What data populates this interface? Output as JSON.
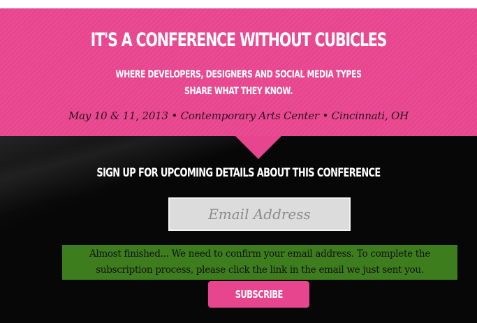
{
  "hero": {
    "title": "IT'S A CONFERENCE WITHOUT CUBICLES",
    "subtitle_line1": "WHERE DEVELOPERS, DESIGNERS AND SOCIAL MEDIA TYPES",
    "subtitle_line2": "SHARE WHAT THEY KNOW.",
    "event_details": "May 10 & 11, 2013 • Contemporary Arts Center • Cincinnati, OH"
  },
  "signup": {
    "heading": "SIGN UP FOR UPCOMING DETAILS ABOUT THIS CONFERENCE",
    "email_placeholder": "Email Address",
    "email_value": "",
    "confirmation_message": "Almost finished... We need to confirm your email address. To complete the subscription process, please click the link in the email we just sent you.",
    "subscribe_label": "SUBSCRIBE"
  },
  "colors": {
    "accent_pink": "#e8458f",
    "success_green": "#3e7d1e",
    "background_dark": "#070707"
  }
}
